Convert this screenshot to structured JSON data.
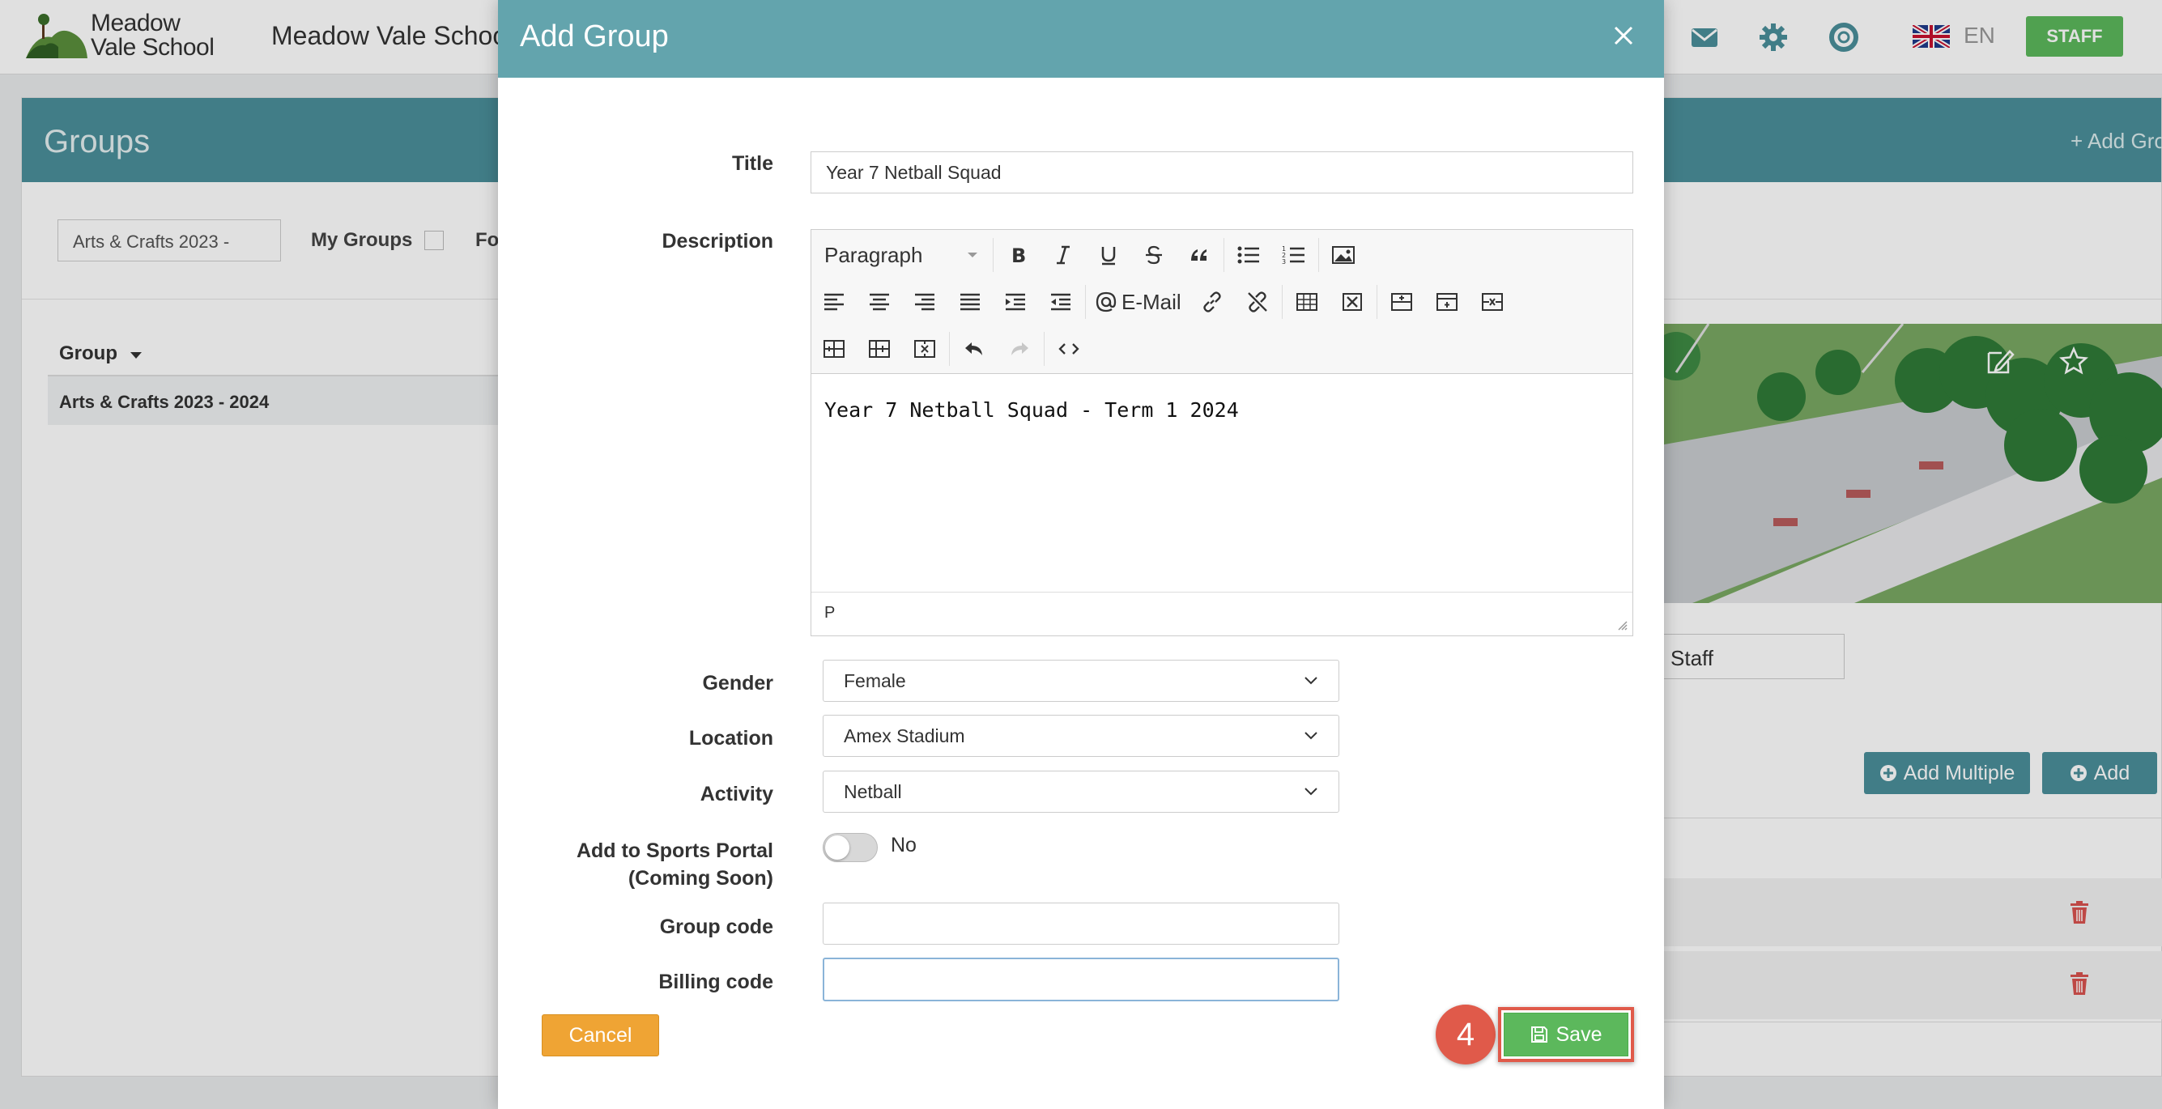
{
  "app": {
    "logo_line1": "Meadow",
    "logo_line2": "Vale School",
    "school_name": "Meadow Vale School",
    "language": "EN",
    "role_button": "STAFF",
    "icons": [
      "mail-icon",
      "gear-icon",
      "support-icon",
      "uk-flag-icon"
    ]
  },
  "groups_page": {
    "title": "Groups",
    "add_group_link": "Add Gro",
    "filter_value": "Arts & Crafts 2023 -",
    "my_groups_label": "My Groups",
    "truncated_label": "Fo",
    "table_header": "Group",
    "rows": [
      "Arts & Crafts 2023 - 2024"
    ],
    "staff_field": "Staff",
    "add_multiple_label": "Add Multiple",
    "add_label": "Add"
  },
  "modal": {
    "title": "Add Group",
    "fields": {
      "title_label": "Title",
      "title_value": "Year 7 Netball Squad",
      "description_label": "Description",
      "gender_label": "Gender",
      "gender_value": "Female",
      "location_label": "Location",
      "location_value": "Amex Stadium",
      "activity_label": "Activity",
      "activity_value": "Netball",
      "sports_portal_label_1": "Add to Sports Portal",
      "sports_portal_label_2": "(Coming Soon)",
      "sports_portal_value": "No",
      "group_code_label": "Group code",
      "group_code_value": "",
      "billing_code_label": "Billing code",
      "billing_code_value": ""
    },
    "editor": {
      "block_format": "Paragraph",
      "email_button": "E-Mail",
      "content": "Year 7 Netball Squad - Term 1 2024",
      "path": "P"
    },
    "cancel_label": "Cancel",
    "save_label": "Save",
    "step_number": "4"
  },
  "colors": {
    "modal_header": "#63a4ad",
    "page_header": "#4b8f9a",
    "save": "#5cb85c",
    "cancel": "#efa434",
    "highlight": "#e05a4a",
    "delete": "#d9534f"
  }
}
